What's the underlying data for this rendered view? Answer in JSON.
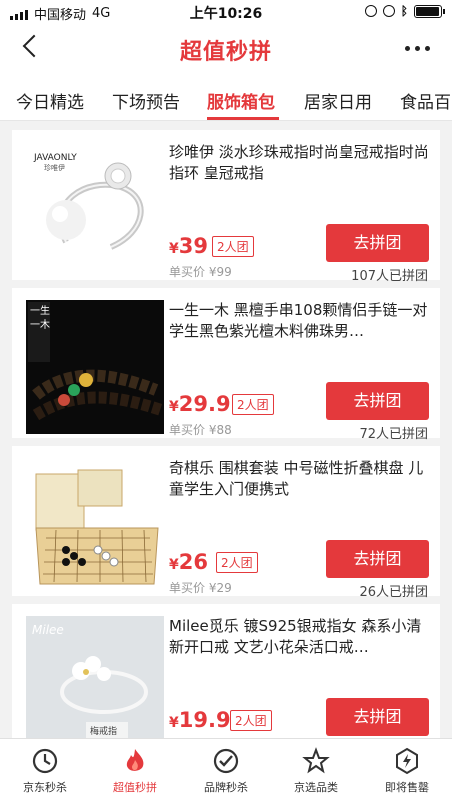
{
  "status_bar": {
    "carrier": "中国移动",
    "network": "4G",
    "time": "上午10:26"
  },
  "nav": {
    "title": "超值秒拼"
  },
  "tabs": [
    {
      "label": "今日精选",
      "active": false
    },
    {
      "label": "下场预告",
      "active": false
    },
    {
      "label": "服饰箱包",
      "active": true
    },
    {
      "label": "居家日用",
      "active": false
    },
    {
      "label": "食品百",
      "active": false
    }
  ],
  "products": [
    {
      "title": "珍唯伊 淡水珍珠戒指时尚皇冠戒指时尚指环 皇冠戒指",
      "currency": "¥",
      "price": "39",
      "group": "2人团",
      "single_label": "单买价",
      "single_price": "¥99",
      "cta": "去拼团",
      "joined": "107人已拼团",
      "brand_mark": "JAVAONLY"
    },
    {
      "title": "一生一木 黑檀手串108颗情侣手链一对学生黑色紫光檀木料佛珠男…",
      "currency": "¥",
      "price": "29.9",
      "group": "2人团",
      "single_label": "单买价",
      "single_price": "¥88",
      "cta": "去拼团",
      "joined": "72人已拼团",
      "brand_mark": "一生一木"
    },
    {
      "title": "奇棋乐 围棋套装 中号磁性折叠棋盘 儿童学生入门便携式",
      "currency": "¥",
      "price": "26",
      "group": "2人团",
      "single_label": "单买价",
      "single_price": "¥29",
      "cta": "去拼团",
      "joined": "26人已拼团",
      "brand_mark": ""
    },
    {
      "title": "Milee觅乐 镀S925银戒指女 森系小清新开口戒 文艺小花朵活口戒…",
      "currency": "¥",
      "price": "19.9",
      "group": "2人团",
      "cta": "去拼团",
      "brand_mark": "Milee",
      "caption": "梅戒指"
    }
  ],
  "bottom_nav": [
    {
      "label": "京东秒杀",
      "icon": "clock-icon",
      "active": false
    },
    {
      "label": "超值秒拼",
      "icon": "flame-icon",
      "active": true
    },
    {
      "label": "品牌秒杀",
      "icon": "badge-check-icon",
      "active": false
    },
    {
      "label": "京选品类",
      "icon": "star-icon",
      "active": false
    },
    {
      "label": "即将售罄",
      "icon": "lightning-icon",
      "active": false
    }
  ],
  "colors": {
    "accent": "#e4393c",
    "background": "#f2f2f2"
  }
}
